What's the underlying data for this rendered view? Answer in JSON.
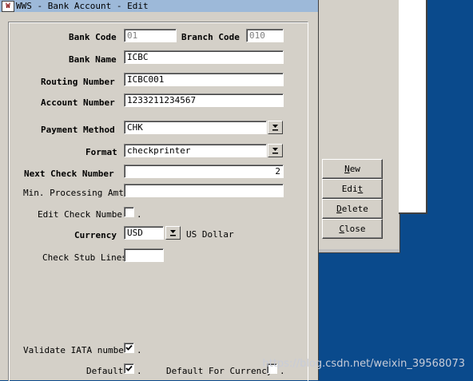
{
  "window": {
    "title": "WWS - Bank Account - Edit",
    "icon": "app-icon"
  },
  "form": {
    "bank_code_label": "Bank Code",
    "bank_code_value": "01",
    "branch_code_label": "Branch Code",
    "branch_code_value": "010",
    "bank_name_label": "Bank Name",
    "bank_name_value": "ICBC",
    "routing_number_label": "Routing Number",
    "routing_number_value": "ICBC001",
    "account_number_label": "Account Number",
    "account_number_value": "1233211234567",
    "payment_method_label": "Payment Method",
    "payment_method_value": "CHK",
    "format_label": "Format",
    "format_value": "checkprinter",
    "next_check_number_label": "Next Check Number",
    "next_check_number_value": "2",
    "min_processing_amt_label": "Min. Processing Amt.",
    "min_processing_amt_value": "",
    "edit_check_number_label": "Edit Check Number",
    "edit_check_number_checked": false,
    "currency_label": "Currency",
    "currency_value": "USD",
    "currency_desc": "US Dollar",
    "check_stub_lines_label": "Check Stub Lines",
    "check_stub_lines_value": "",
    "validate_iata_label": "Validate IATA number",
    "validate_iata_checked": true,
    "default_label": "Default",
    "default_checked": true,
    "default_for_currency_label": "Default For Currency",
    "default_for_currency_checked": false,
    "dot": "."
  },
  "side_buttons": {
    "new_rest": "ew",
    "new_key": "N",
    "edit_pre": "Edi",
    "edit_key": "t",
    "delete_key": "D",
    "delete_rest": "elete",
    "close_key": "C",
    "close_rest": "lose"
  },
  "watermark": "https://blog.csdn.net/weixin_39568073",
  "colors": {
    "desktop": "#0a4a8c",
    "dialog": "#d4d0c8",
    "titlebar": "#9db9d9"
  }
}
